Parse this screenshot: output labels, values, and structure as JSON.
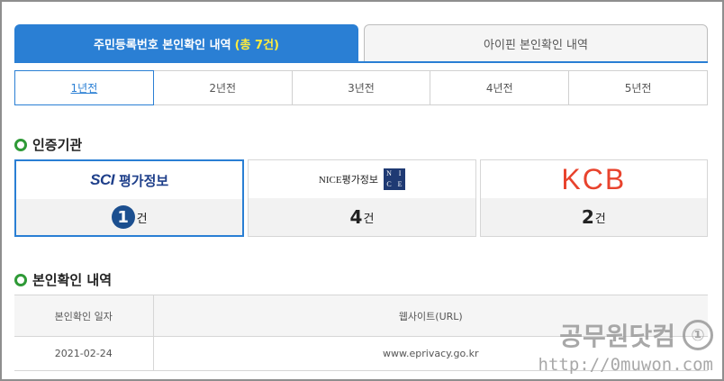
{
  "main_tabs": {
    "resident_label": "주민등록번호 본인확인 내역",
    "resident_count": "(총 7건)",
    "ipin_label": "아이핀 본인확인 내역"
  },
  "year_tabs": [
    "1년전",
    "2년전",
    "3년전",
    "4년전",
    "5년전"
  ],
  "agency_section": {
    "title": "인증기관"
  },
  "agencies": [
    {
      "logo_text": "SCI",
      "logo_kr": "평가정보",
      "count": "1",
      "unit": "건"
    },
    {
      "logo_text": "NICE평가정보",
      "logo_box": [
        "N",
        "I",
        "C",
        "E"
      ],
      "count": "4",
      "unit": "건"
    },
    {
      "logo_text": "KCB",
      "count": "2",
      "unit": "건"
    }
  ],
  "history_section": {
    "title": "본인확인 내역"
  },
  "history_table": {
    "headers": [
      "본인확인 일자",
      "웹사이트(URL)"
    ],
    "rows": [
      [
        "2021-02-24",
        "www.eprivacy.go.kr"
      ]
    ]
  },
  "watermark": {
    "title": "공무원닷컴",
    "url": "http://0muwon.com"
  },
  "colors": {
    "primary": "#2a7fd4",
    "count_highlight": "#ffec3d",
    "bullet": "#2f9a37",
    "kcb": "#e8432d",
    "sci": "#1e3f8a"
  }
}
